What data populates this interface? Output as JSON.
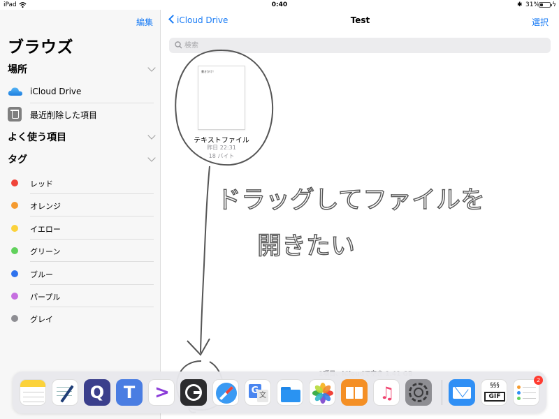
{
  "status_bar": {
    "device": "iPad",
    "time": "0:40",
    "battery_percent": "31%",
    "battery_level": 0.31
  },
  "sidebar": {
    "edit_label": "編集",
    "title": "ブラウズ",
    "locations_header": "場所",
    "locations": [
      {
        "label": "iCloud Drive",
        "icon": "icloud-icon"
      },
      {
        "label": "最近削除した項目",
        "icon": "trash-icon"
      }
    ],
    "favorites_header": "よく使う項目",
    "tags_header": "タグ",
    "tags": [
      {
        "label": "レッド",
        "color": "#f0443a"
      },
      {
        "label": "オレンジ",
        "color": "#f59b30"
      },
      {
        "label": "イエロー",
        "color": "#fbd23b"
      },
      {
        "label": "グリーン",
        "color": "#61d15c"
      },
      {
        "label": "ブルー",
        "color": "#2f73ee"
      },
      {
        "label": "パープル",
        "color": "#c66fe0"
      },
      {
        "label": "グレイ",
        "color": "#8e8e93"
      }
    ]
  },
  "main": {
    "back_label": "iCloud Drive",
    "title": "Test",
    "select_label": "選択",
    "search_placeholder": "検索",
    "file": {
      "thumb_text": "書きかけ！",
      "name": "テキストファイル",
      "date": "昨日 22:31",
      "size": "18 バイト"
    },
    "footer": "1項目、iCloudで空き 1.41 GB"
  },
  "annotation": {
    "line1": "ドラッグしてファイルを",
    "line2": "開きたい"
  },
  "dock": {
    "apps": [
      {
        "name": "notes-app-icon",
        "color": "#ffffff"
      },
      {
        "name": "writing-app-icon",
        "color": "#ffffff"
      },
      {
        "name": "q-app-icon",
        "color": "#3b3f8c"
      },
      {
        "name": "t-app-icon",
        "color": "#4a7de2"
      },
      {
        "name": "terminal-app-icon",
        "color": "#ffffff"
      },
      {
        "name": "browser-app-icon",
        "color": "#2c2c2e"
      },
      {
        "name": "safari-app-icon",
        "color": "#ffffff"
      },
      {
        "name": "translate-app-icon",
        "color": "#ffffff"
      },
      {
        "name": "files-app-icon",
        "color": "#ffffff"
      },
      {
        "name": "photos-app-icon",
        "color": "#ffffff"
      },
      {
        "name": "books-app-icon",
        "color": "#f48f25"
      },
      {
        "name": "music-app-icon",
        "color": "#ffffff"
      },
      {
        "name": "settings-app-icon",
        "color": "#8e8e93"
      },
      {
        "name": "mail-app-icon",
        "color": "#2f8ff5"
      },
      {
        "name": "gif-app-icon",
        "color": "#ffffff"
      },
      {
        "name": "reminders-app-icon",
        "color": "#ffffff"
      }
    ],
    "badge_count": "2"
  }
}
